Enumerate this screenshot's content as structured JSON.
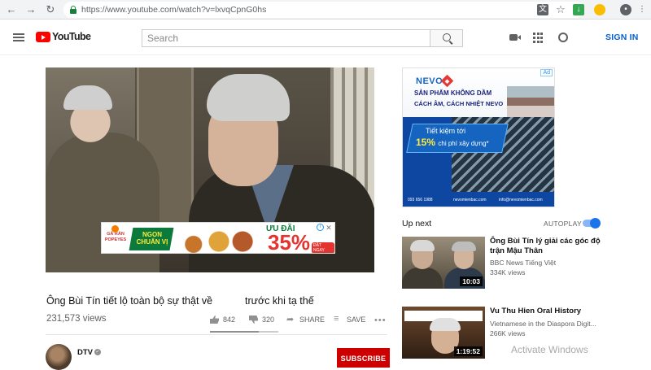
{
  "browser": {
    "url": "https://www.youtube.com/watch?v=lxvqCpnG0hs"
  },
  "header": {
    "logo_text": "YouTube",
    "search_placeholder": "Search",
    "sign_in": "SIGN IN"
  },
  "player": {
    "overlay_ad": {
      "brand": "GÀ RÁN POPEYES",
      "slogan": "NGON CHUẨN VỊ",
      "promo_label": "ƯU ĐÃI",
      "promo_value": "35%",
      "promo_tag": "ĐẶT NGAY"
    }
  },
  "video": {
    "title_part1": "Ông Bùi Tín tiết lộ toàn bộ sự thật về",
    "title_part2": "trước khi tạ thế",
    "views": "231,573 views",
    "likes": "842",
    "dislikes": "320",
    "share_label": "SHARE",
    "save_label": "SAVE",
    "like_ratio": 0.72
  },
  "owner": {
    "name": "DTV",
    "subscribe_label": "SUBSCRIBE"
  },
  "sidebar_ad": {
    "badge": "Ad",
    "logo": "NEVO",
    "headline1": "SẢN PHẨM KHÔNG DẦM",
    "headline2": "CÁCH ÂM, CÁCH NHIỆT NEVO",
    "banner_line1": "Tiết kiệm tới",
    "banner_pct": "15%",
    "banner_rest": "chi phí xây dựng*",
    "footer_phone": "093 656 1988",
    "footer_site": "nevomienbac.com",
    "footer_email": "info@nevomienbac.com"
  },
  "up_next": {
    "heading": "Up next",
    "autoplay_label": "AUTOPLAY",
    "autoplay_on": true,
    "items": [
      {
        "title": "Ông Bùi Tín lý giải các góc độ trận Mậu Thân",
        "channel": "BBC News Tiếng Việt",
        "views": "334K views",
        "duration": "10:03"
      },
      {
        "title": "Vu Thu Hien Oral History",
        "channel": "Vietnamese in the Diaspora Digit...",
        "views": "266K views",
        "duration": "1:19:52"
      }
    ]
  },
  "os": {
    "watermark": "Activate Windows"
  }
}
